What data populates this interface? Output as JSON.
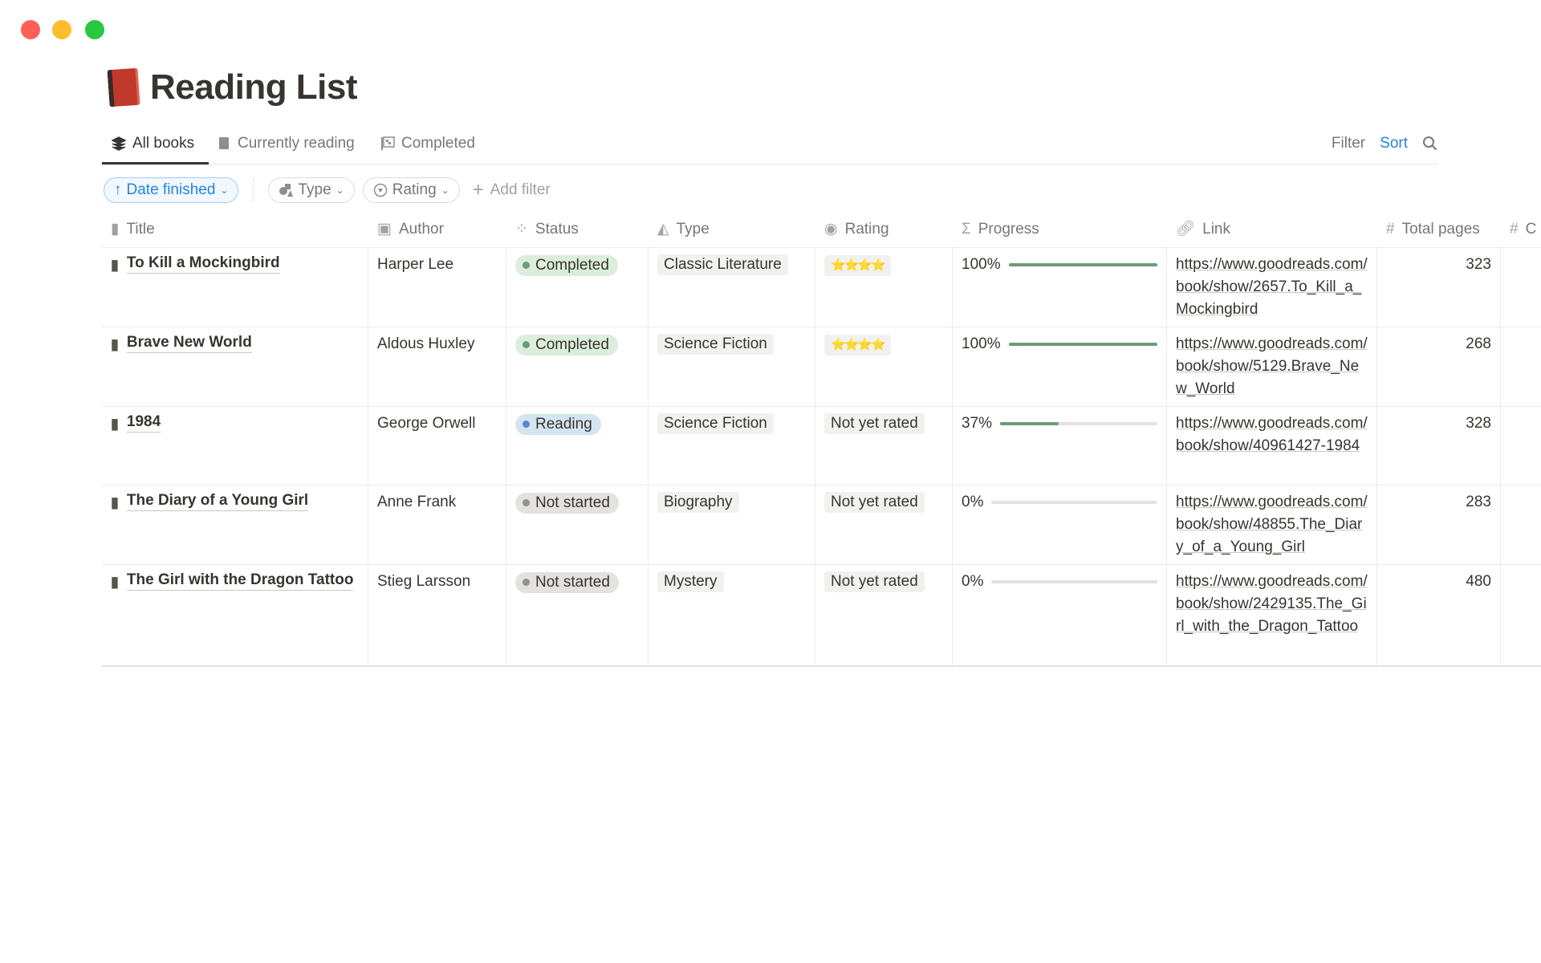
{
  "window": {
    "controls": [
      {
        "name": "close",
        "color": "#fe5f57"
      },
      {
        "name": "minimize",
        "color": "#febc2e"
      },
      {
        "name": "maximize",
        "color": "#28c840"
      }
    ]
  },
  "page": {
    "title": "Reading List",
    "icon": "red-book-icon"
  },
  "tabs": [
    {
      "label": "All books",
      "icon": "layers-icon",
      "active": true
    },
    {
      "label": "Currently reading",
      "icon": "book-icon"
    },
    {
      "label": "Completed",
      "icon": "checkered-flag-icon"
    }
  ],
  "actions": {
    "filter": "Filter",
    "sort": "Sort",
    "search_icon": "search-icon"
  },
  "filters": {
    "sort_pill": "Date finished",
    "type_pill": "Type",
    "rating_pill": "Rating",
    "add_filter": "Add filter"
  },
  "columns": [
    {
      "label": "Title",
      "icon": "page-icon"
    },
    {
      "label": "Author",
      "icon": "person-icon"
    },
    {
      "label": "Status",
      "icon": "status-icon"
    },
    {
      "label": "Type",
      "icon": "shapes-icon"
    },
    {
      "label": "Rating",
      "icon": "select-icon"
    },
    {
      "label": "Progress",
      "icon": "sigma-icon"
    },
    {
      "label": "Link",
      "icon": "link-icon"
    },
    {
      "label": "Total pages",
      "icon": "hash-icon"
    },
    {
      "label": "C",
      "icon": "hash-icon"
    }
  ],
  "status_colors": {
    "Completed": {
      "bg": "#dbeddb",
      "dot": "#6c9b7d"
    },
    "Reading": {
      "bg": "#d3e5ef",
      "dot": "#5e87c9"
    },
    "Not started": {
      "bg": "#e3e2e0",
      "dot": "#91918e"
    }
  },
  "rows": [
    {
      "title": "To Kill a Mockingbird",
      "author": "Harper Lee",
      "status": "Completed",
      "type": "Classic Literature",
      "rating": "⭐⭐⭐⭐",
      "progress_label": "100%",
      "progress": 1.0,
      "link": "https://www.goodreads.com/book/show/2657.To_Kill_a_Mockingbird",
      "pages": "323"
    },
    {
      "title": "Brave New World",
      "author": "Aldous Huxley",
      "status": "Completed",
      "type": "Science Fiction",
      "rating": "⭐⭐⭐⭐",
      "progress_label": "100%",
      "progress": 1.0,
      "link": "https://www.goodreads.com/book/show/5129.Brave_New_World",
      "pages": "268"
    },
    {
      "title": "1984",
      "author": "George Orwell",
      "status": "Reading",
      "type": "Science Fiction",
      "rating": "Not yet rated",
      "progress_label": "37%",
      "progress": 0.37,
      "link": "https://www.goodreads.com/book/show/40961427-1984",
      "pages": "328"
    },
    {
      "title": "The Diary of a Young Girl",
      "author": "Anne Frank",
      "status": "Not started",
      "type": "Biography",
      "rating": "Not yet rated",
      "progress_label": "0%",
      "progress": 0,
      "link": "https://www.goodreads.com/book/show/48855.The_Diary_of_a_Young_Girl",
      "pages": "283"
    },
    {
      "title": "The Girl with the Dragon Tattoo",
      "author": "Stieg Larsson",
      "status": "Not started",
      "type": "Mystery",
      "rating": "Not yet rated",
      "progress_label": "0%",
      "progress": 0,
      "link": "https://www.goodreads.com/book/show/2429135.The_Girl_with_the_Dragon_Tattoo",
      "pages": "480"
    }
  ]
}
